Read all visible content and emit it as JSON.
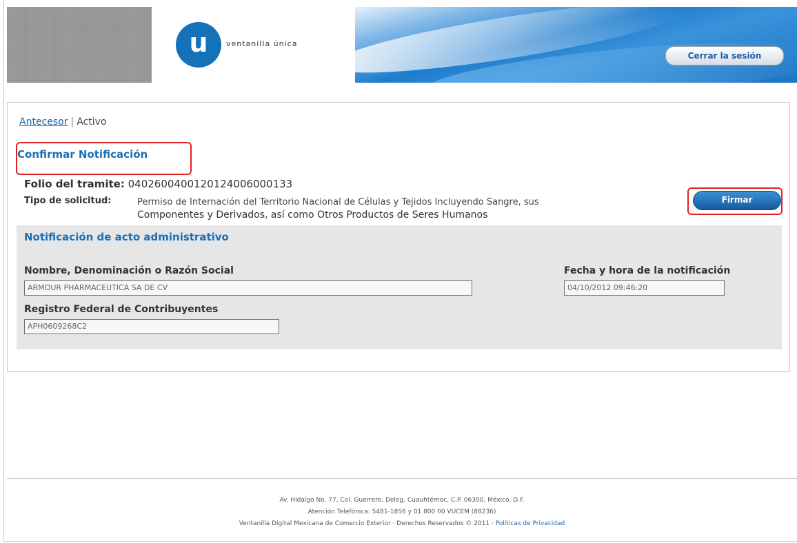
{
  "header": {
    "logo_letter": "u",
    "logo_text": "ventanilla única",
    "logout_label": "Cerrar la sesión"
  },
  "breadcrumb": {
    "prev_link": "Antecesor",
    "separator": "|",
    "current": "Activo"
  },
  "page_title": "Confirmar Notificación",
  "folio": {
    "label": "Folio del tramite:",
    "value": "0402600400120124006000133"
  },
  "tipo": {
    "label": "Tipo de solicitud:",
    "value_line1": "Permiso de Internación del Territorio Nacional de Células y Tejidos Incluyendo Sangre, sus",
    "value_line2": "Componentes y Derivados, así como Otros Productos de Seres Humanos"
  },
  "sign_button_label": "Firmar",
  "notification": {
    "title": "Notificación de acto administrativo",
    "name_label": "Nombre, Denominación o Razón Social",
    "name_value": "ARMOUR PHARMACEUTICA SA DE CV",
    "date_label": "Fecha y hora de la notificación",
    "date_value": "04/10/2012 09:46:20",
    "rfc_label": "Registro Federal de Contribuyentes",
    "rfc_value": "APH0609268C2"
  },
  "footer": {
    "line1": "Av. Hidalgo No. 77, Col. Guerrero, Deleg. Cuauhtémoc, C.P. 06300, México, D.F.",
    "line2": "Atención Telefónica: 5481-1856 y 01 800 00 VUCEM (88236)",
    "line3": "Ventanilla Digital Mexicana de Comercio Exterior · Derechos Reservados © 2011 · ",
    "privacy_link": "Políticas de Privacidad"
  },
  "colors": {
    "brand_blue": "#1672b8",
    "title_blue": "#1c6fb5",
    "highlight_red": "#e02020",
    "section_gray": "#e6e6e6"
  }
}
